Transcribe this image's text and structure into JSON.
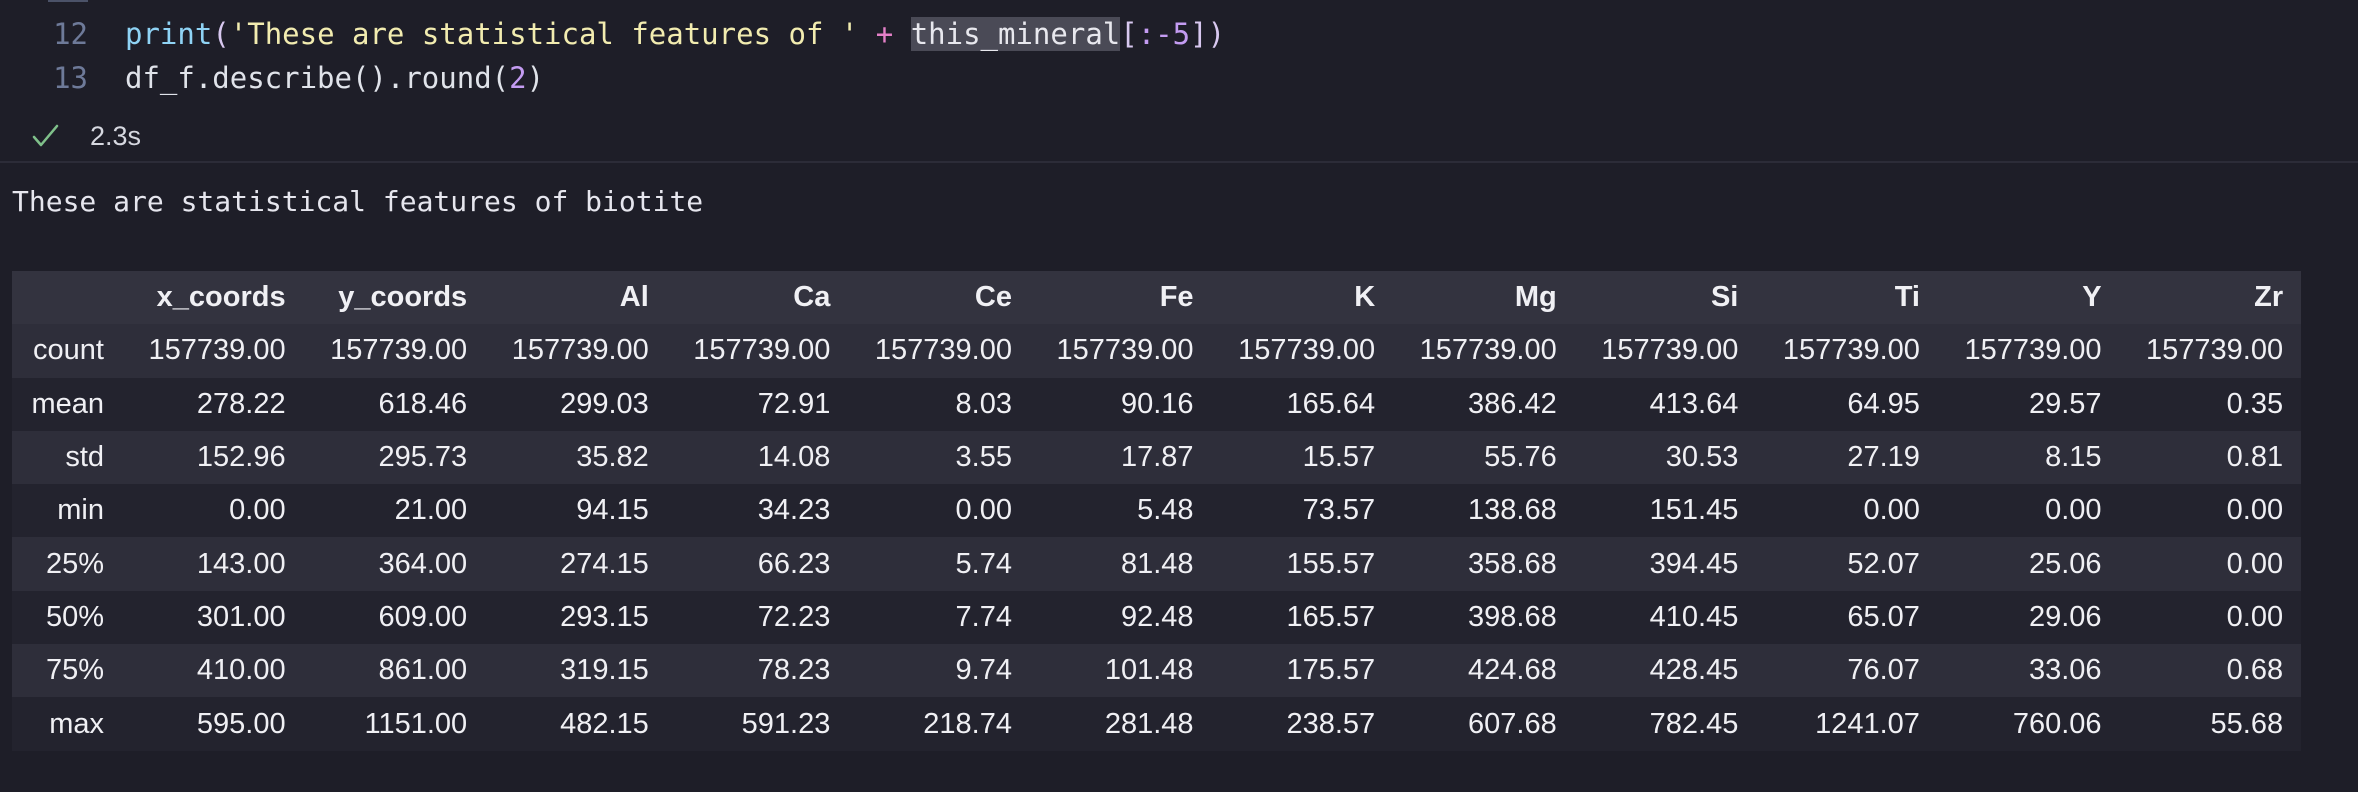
{
  "code": {
    "lines": [
      {
        "number": "12",
        "tokens": [
          {
            "text": "print",
            "kind": "fn"
          },
          {
            "text": "(",
            "kind": "br"
          },
          {
            "text": "'These are statistical features of '",
            "kind": "str"
          },
          {
            "text": " + ",
            "kind": "op"
          },
          {
            "text": "this_mineral",
            "kind": "sel"
          },
          {
            "text": "[",
            "kind": "br"
          },
          {
            "text": ":-5",
            "kind": "num"
          },
          {
            "text": "]",
            "kind": "br"
          },
          {
            "text": ")",
            "kind": "br"
          }
        ]
      },
      {
        "number": "13",
        "tokens": [
          {
            "text": "df_f.describe().round(",
            "kind": "plain"
          },
          {
            "text": "2",
            "kind": "num"
          },
          {
            "text": ")",
            "kind": "plain"
          }
        ]
      }
    ],
    "exec_time": "2.3s",
    "status_icon": "check-icon",
    "status_color": "#7fc08a"
  },
  "output": {
    "stdout": "These are statistical features of biotite",
    "table": {
      "columns": [
        "x_coords",
        "y_coords",
        "Al",
        "Ca",
        "Ce",
        "Fe",
        "K",
        "Mg",
        "Si",
        "Ti",
        "Y",
        "Zr"
      ],
      "rows": [
        {
          "label": "count",
          "values": [
            "157739.00",
            "157739.00",
            "157739.00",
            "157739.00",
            "157739.00",
            "157739.00",
            "157739.00",
            "157739.00",
            "157739.00",
            "157739.00",
            "157739.00",
            "157739.00"
          ]
        },
        {
          "label": "mean",
          "values": [
            "278.22",
            "618.46",
            "299.03",
            "72.91",
            "8.03",
            "90.16",
            "165.64",
            "386.42",
            "413.64",
            "64.95",
            "29.57",
            "0.35"
          ]
        },
        {
          "label": "std",
          "values": [
            "152.96",
            "295.73",
            "35.82",
            "14.08",
            "3.55",
            "17.87",
            "15.57",
            "55.76",
            "30.53",
            "27.19",
            "8.15",
            "0.81"
          ]
        },
        {
          "label": "min",
          "values": [
            "0.00",
            "21.00",
            "94.15",
            "34.23",
            "0.00",
            "5.48",
            "73.57",
            "138.68",
            "151.45",
            "0.00",
            "0.00",
            "0.00"
          ]
        },
        {
          "label": "25%",
          "values": [
            "143.00",
            "364.00",
            "274.15",
            "66.23",
            "5.74",
            "81.48",
            "155.57",
            "358.68",
            "394.45",
            "52.07",
            "25.06",
            "0.00"
          ]
        },
        {
          "label": "50%",
          "values": [
            "301.00",
            "609.00",
            "293.15",
            "72.23",
            "7.74",
            "92.48",
            "165.57",
            "398.68",
            "410.45",
            "65.07",
            "29.06",
            "0.00"
          ]
        },
        {
          "label": "75%",
          "values": [
            "410.00",
            "861.00",
            "319.15",
            "78.23",
            "9.74",
            "101.48",
            "175.57",
            "424.68",
            "428.45",
            "76.07",
            "33.06",
            "0.68"
          ]
        },
        {
          "label": "max",
          "values": [
            "595.00",
            "1151.00",
            "482.15",
            "591.23",
            "218.74",
            "281.48",
            "238.57",
            "607.68",
            "782.45",
            "1241.07",
            "760.06",
            "55.68"
          ]
        }
      ]
    }
  }
}
